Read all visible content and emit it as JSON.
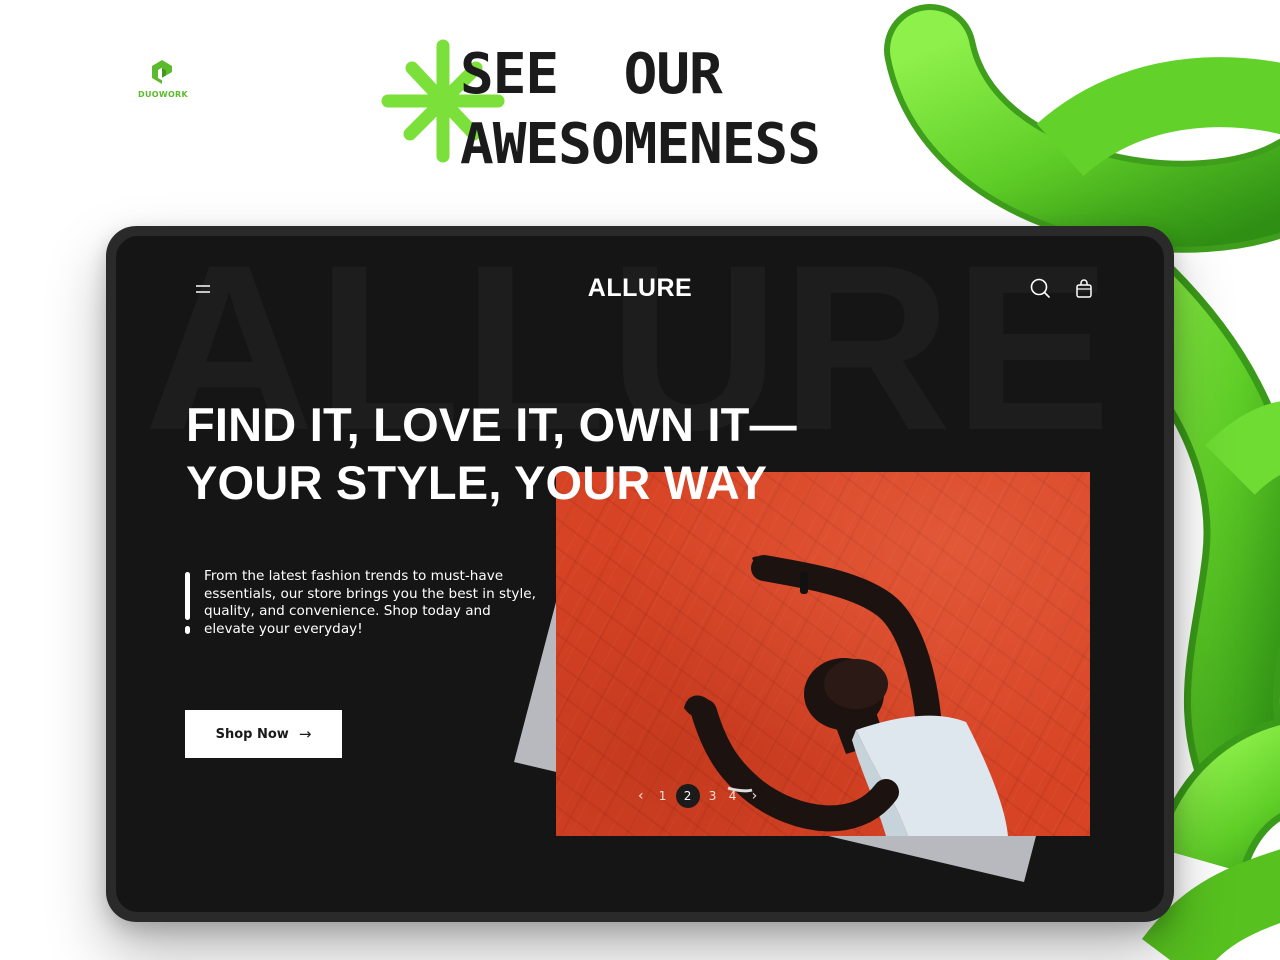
{
  "brand": {
    "name": "DUOWORK",
    "color": "#5cbb2d"
  },
  "promo": {
    "headline_lines": [
      "SEE  OUR",
      "AWESOMENESS"
    ],
    "accent": "#7be13a"
  },
  "store": {
    "watermark": "ALLURE",
    "logo": "ALLURE",
    "nav": {
      "menu_icon": "menu-icon",
      "search_icon": "search-icon",
      "cart_icon": "shopping-bag-icon"
    },
    "hero": {
      "title_lines": [
        "FIND IT, LOVE IT, OWN IT—",
        "YOUR STYLE, YOUR WAY"
      ],
      "description": "From the latest fashion trends to must-have essentials, our store brings you the best in style, quality, and convenience. Shop today and elevate your everyday!",
      "cta_label": "Shop Now",
      "cta_arrow": "→"
    },
    "gallery": {
      "prev": "‹",
      "next": "›",
      "pages": [
        "1",
        "2",
        "3",
        "4"
      ],
      "active_page": "2"
    }
  }
}
